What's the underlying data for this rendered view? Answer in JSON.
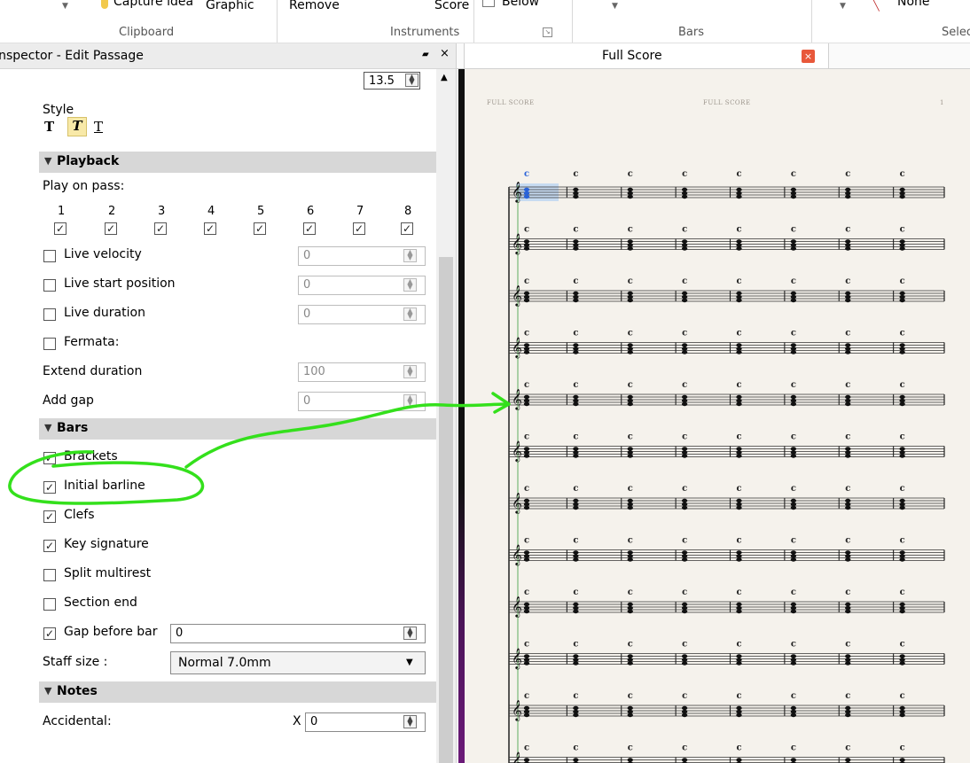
{
  "ribbon": {
    "items": [
      "Capture idea",
      "Graphic",
      "Remove",
      "Score",
      "Below",
      "None"
    ],
    "groups": [
      "Clipboard",
      "Instruments",
      "Bars",
      "Selec"
    ]
  },
  "panel": {
    "title": "Inspector - Edit Passage",
    "top_value": "13.5",
    "style_label": "Style",
    "style_buttons": [
      "T",
      "T",
      "T"
    ],
    "playback": {
      "header": "Playback",
      "play_on_pass_label": "Play on pass:",
      "pass_numbers": [
        "1",
        "2",
        "3",
        "4",
        "5",
        "6",
        "7",
        "8"
      ],
      "rows": [
        {
          "label": "Live velocity",
          "value": "0"
        },
        {
          "label": "Live start position",
          "value": "0"
        },
        {
          "label": "Live duration",
          "value": "0"
        }
      ],
      "fermata_label": "Fermata:",
      "extend_duration_label": "Extend duration",
      "extend_duration_value": "100",
      "add_gap_label": "Add gap",
      "add_gap_value": "0"
    },
    "bars": {
      "header": "Bars",
      "options": [
        {
          "label": "Brackets",
          "checked": true
        },
        {
          "label": "Initial barline",
          "checked": true
        },
        {
          "label": "Clefs",
          "checked": true
        },
        {
          "label": "Key signature",
          "checked": true
        },
        {
          "label": "Split multirest",
          "checked": false
        },
        {
          "label": "Section end",
          "checked": false
        }
      ],
      "gap_before_bar_label": "Gap before bar",
      "gap_before_bar_value": "0",
      "staff_size_label": "Staff size :",
      "staff_size_value": "Normal 7.0mm"
    },
    "notes": {
      "header": "Notes",
      "accidental_label": "Accidental:",
      "x_label": "X",
      "x_value": "0"
    }
  },
  "score": {
    "tab_title": "Full Score",
    "header_left": "FULL SCORE",
    "header_center": "FULL SCORE",
    "page_number": "1",
    "chord_symbol": "C",
    "staff_count": 12,
    "bars_per_staff": 8
  },
  "colors": {
    "annotation": "#34e01c",
    "selection": "#bcd4f2",
    "tab_close": "#e8583a"
  }
}
